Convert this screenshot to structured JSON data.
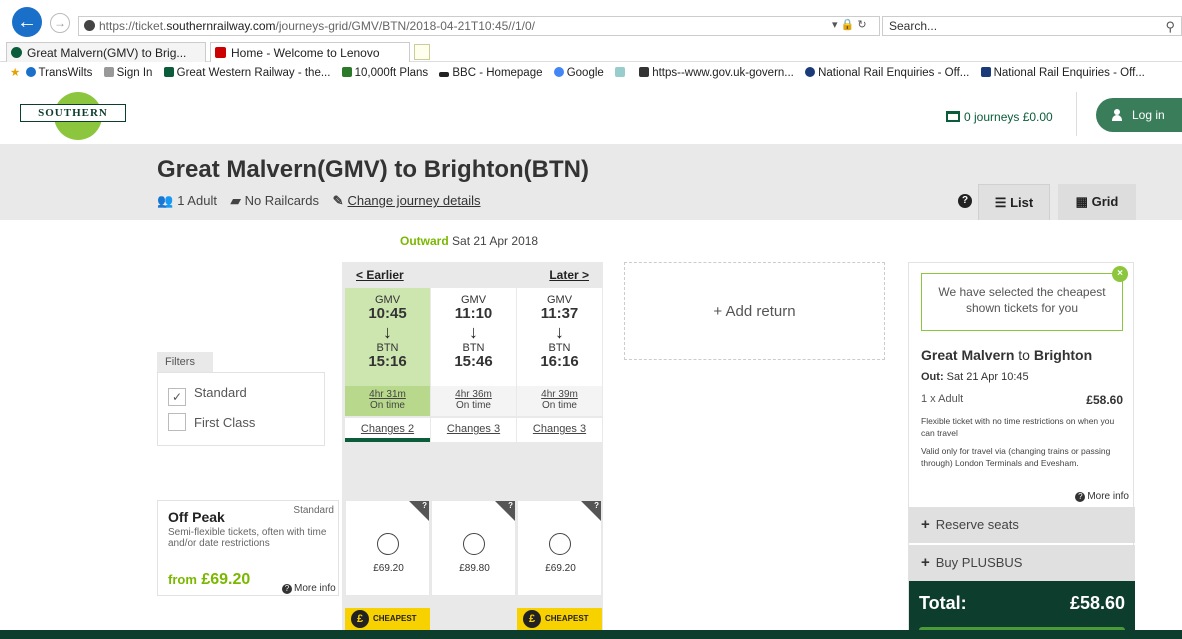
{
  "browser": {
    "url_prefix": "https://ticket.",
    "url_domain": "southernrailway.com",
    "url_path": "/journeys-grid/GMV/BTN/2018-04-21T10:45//1/0/",
    "url_controls": "▾ 🔒 ↻",
    "search_placeholder": "Search...",
    "tabs": [
      {
        "label": "Great Malvern(GMV) to Brig...",
        "close": "×"
      },
      {
        "label": "Home - Welcome to Lenovo",
        "close": ""
      }
    ],
    "favorites": [
      "TransWilts",
      "Sign In",
      "Great Western Railway - the...",
      "10,000ft Plans",
      "BBC - Homepage",
      "Google",
      "",
      "https--www.gov.uk-govern...",
      "National Rail Enquiries - Off...",
      "National Rail Enquiries - Off..."
    ]
  },
  "header": {
    "logo": "SOUTHERN",
    "basket": "0 journeys  £0.00",
    "login": "Log in"
  },
  "journey": {
    "title": "Great Malvern(GMV) to Brighton(BTN)",
    "passengers": "1 Adult",
    "railcards": "No Railcards",
    "change_link": "Change journey details",
    "help": "?",
    "list_label": "List",
    "grid_label": "Grid"
  },
  "outward": {
    "label": "Outward",
    "date": "Sat 21 Apr 2018"
  },
  "nav": {
    "earlier": "< Earlier",
    "later": "Later >"
  },
  "trains": [
    {
      "from": "GMV",
      "dep": "10:45",
      "arrow": "↓",
      "to": "BTN",
      "arr": "15:16",
      "duration": "4hr 31m",
      "status": "On time",
      "changes": "Changes 2"
    },
    {
      "from": "GMV",
      "dep": "11:10",
      "arrow": "↓",
      "to": "BTN",
      "arr": "15:46",
      "duration": "4hr 36m",
      "status": "On time",
      "changes": "Changes 3"
    },
    {
      "from": "GMV",
      "dep": "11:37",
      "arrow": "↓",
      "to": "BTN",
      "arr": "16:16",
      "duration": "4hr 39m",
      "status": "On time",
      "changes": "Changes 3"
    }
  ],
  "add_return": "+ Add return",
  "filters": {
    "label": "Filters",
    "standard": "Standard",
    "first_class": "First Class",
    "standard_check": "✓"
  },
  "fare": {
    "category": "Standard",
    "title": "Off Peak",
    "desc": "Semi-flexible tickets, often with time and/or date restrictions",
    "from_label": "from",
    "from_price": "£69.20",
    "more_info": "More info",
    "prices": [
      "£69.20",
      "£89.80",
      "£69.20"
    ],
    "corner_q": "?",
    "cheapest_label": "CHEAPEST",
    "pound": "£"
  },
  "summary": {
    "tip": "We have selected the cheapest shown tickets for you",
    "tip_close": "×",
    "route_from": "Great Malvern",
    "route_to_word": "to",
    "route_to": "Brighton",
    "out_label": "Out:",
    "out_value": "Sat 21 Apr 10:45",
    "pax": "1 x Adult",
    "pax_price": "£58.60",
    "note1": "Flexible ticket with no time restrictions on when you can travel",
    "note2": "Valid only for travel via (changing trains or passing through) London Terminals and Evesham.",
    "more_info": "More info",
    "reserve": "Reserve seats",
    "plusbus": "Buy PLUSBUS",
    "plus": "+",
    "total_label": "Total:",
    "total_value": "£58.60"
  },
  "colors": {
    "brand_dark": "#0d3d2d",
    "brand_green": "#8cc63f",
    "accent_green": "#7ab800",
    "cheapest_yellow": "#f7d100"
  }
}
